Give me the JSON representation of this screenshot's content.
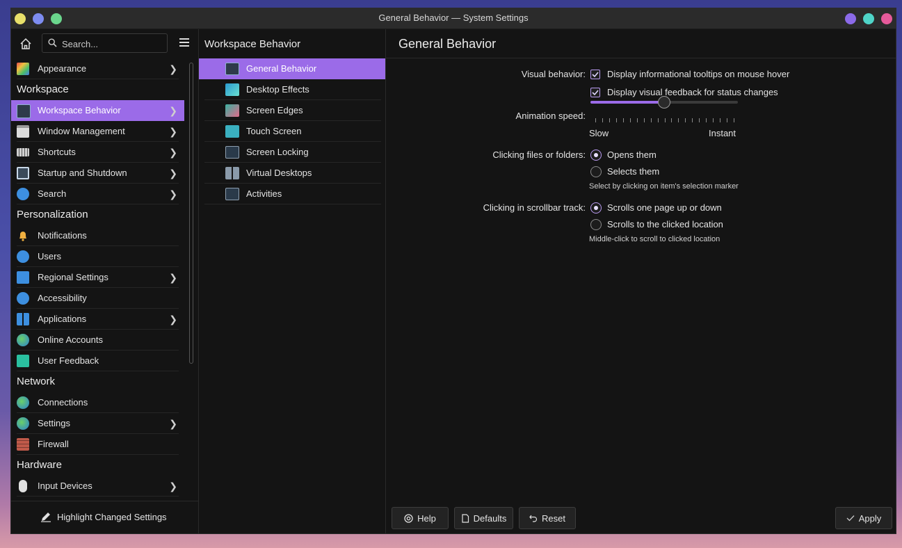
{
  "window": {
    "title": "General Behavior — System Settings"
  },
  "sidebar": {
    "search_placeholder": "Search...",
    "appearance_label": "Appearance",
    "headers": {
      "workspace": "Workspace",
      "personalization": "Personalization",
      "network": "Network",
      "hardware": "Hardware"
    },
    "items": {
      "workspace_behavior": "Workspace Behavior",
      "window_management": "Window Management",
      "shortcuts": "Shortcuts",
      "startup_shutdown": "Startup and Shutdown",
      "search": "Search",
      "notifications": "Notifications",
      "users": "Users",
      "regional_settings": "Regional Settings",
      "accessibility": "Accessibility",
      "applications": "Applications",
      "online_accounts": "Online Accounts",
      "user_feedback": "User Feedback",
      "connections": "Connections",
      "settings": "Settings",
      "firewall": "Firewall",
      "input_devices": "Input Devices"
    },
    "highlight_button": "Highlight Changed Settings"
  },
  "middle": {
    "title": "Workspace Behavior",
    "items": [
      "General Behavior",
      "Desktop Effects",
      "Screen Edges",
      "Touch Screen",
      "Screen Locking",
      "Virtual Desktops",
      "Activities"
    ]
  },
  "main": {
    "title": "General Behavior",
    "visual_behavior_label": "Visual behavior:",
    "tooltips_option": "Display informational tooltips on mouse hover",
    "feedback_option": "Display visual feedback for status changes",
    "animation_label": "Animation speed:",
    "slider_min_label": "Slow",
    "slider_max_label": "Instant",
    "animation_speed_fraction": 0.5,
    "clicking_files_label": "Clicking files or folders:",
    "opens_option": "Opens them",
    "selects_option": "Selects them",
    "select_hint": "Select by clicking on item's selection marker",
    "scrollbar_label": "Clicking in scrollbar track:",
    "scroll_page_option": "Scrolls one page up or down",
    "scroll_clicked_option": "Scrolls to the clicked location",
    "scroll_hint": "Middle-click to scroll to clicked location"
  },
  "footer": {
    "help": "Help",
    "defaults": "Defaults",
    "reset": "Reset",
    "apply": "Apply"
  },
  "colors": {
    "accent": "#9b6be8",
    "window_bg": "#141414",
    "titlebar": "#2b2b2b"
  }
}
